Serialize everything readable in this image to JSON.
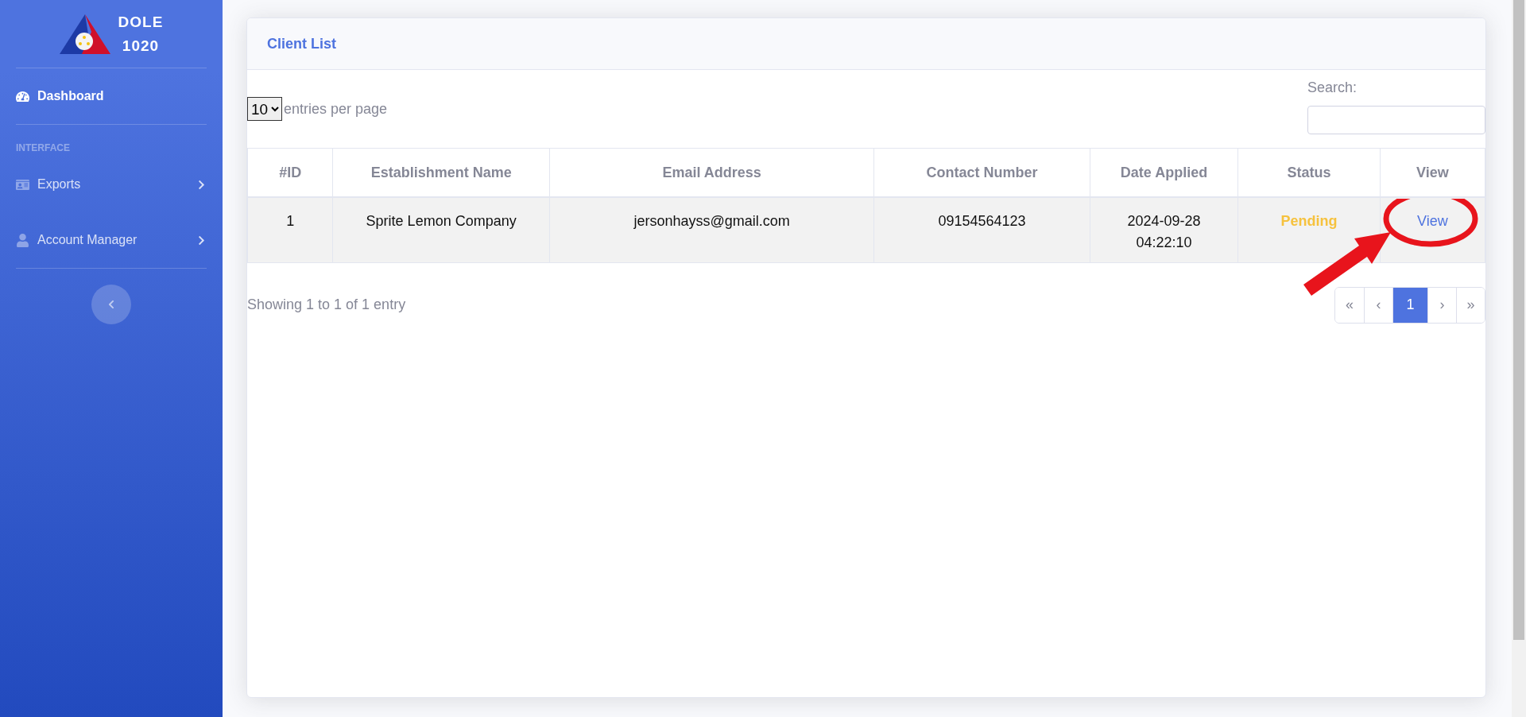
{
  "sidebar": {
    "brand": [
      "DOLE",
      "1020"
    ],
    "items": [
      {
        "label": "Dashboard",
        "selected": true,
        "has_submenu": false
      }
    ],
    "section": "INTERFACE",
    "groups": [
      {
        "label": "Exports",
        "selected": false,
        "has_submenu": true
      },
      {
        "label": "Account Manager",
        "selected": false,
        "has_submenu": true
      }
    ]
  },
  "card": {
    "title": "Client List",
    "length": {
      "value": "10",
      "label": "entries per page"
    },
    "search": {
      "label": "Search:"
    },
    "table": {
      "columns": [
        "#ID",
        "Establishment Name",
        "Email Address",
        "Contact Number",
        "Date Applied",
        "Status",
        "View"
      ],
      "rows": [
        {
          "id": "1",
          "name": "Sprite Lemon Company",
          "email": "jersonhayss@gmail.com",
          "contact": "09154564123",
          "date": [
            "2024-09-28",
            "04:22:10"
          ],
          "status": "Pending",
          "action": "View"
        }
      ]
    },
    "info": "Showing 1 to 1 of 1 entry",
    "pages": [
      {
        "label": "«",
        "selected": false
      },
      {
        "label": "‹",
        "selected": false
      },
      {
        "label": "1",
        "selected": true
      },
      {
        "label": "›",
        "selected": false
      },
      {
        "label": "»",
        "selected": false
      }
    ]
  }
}
